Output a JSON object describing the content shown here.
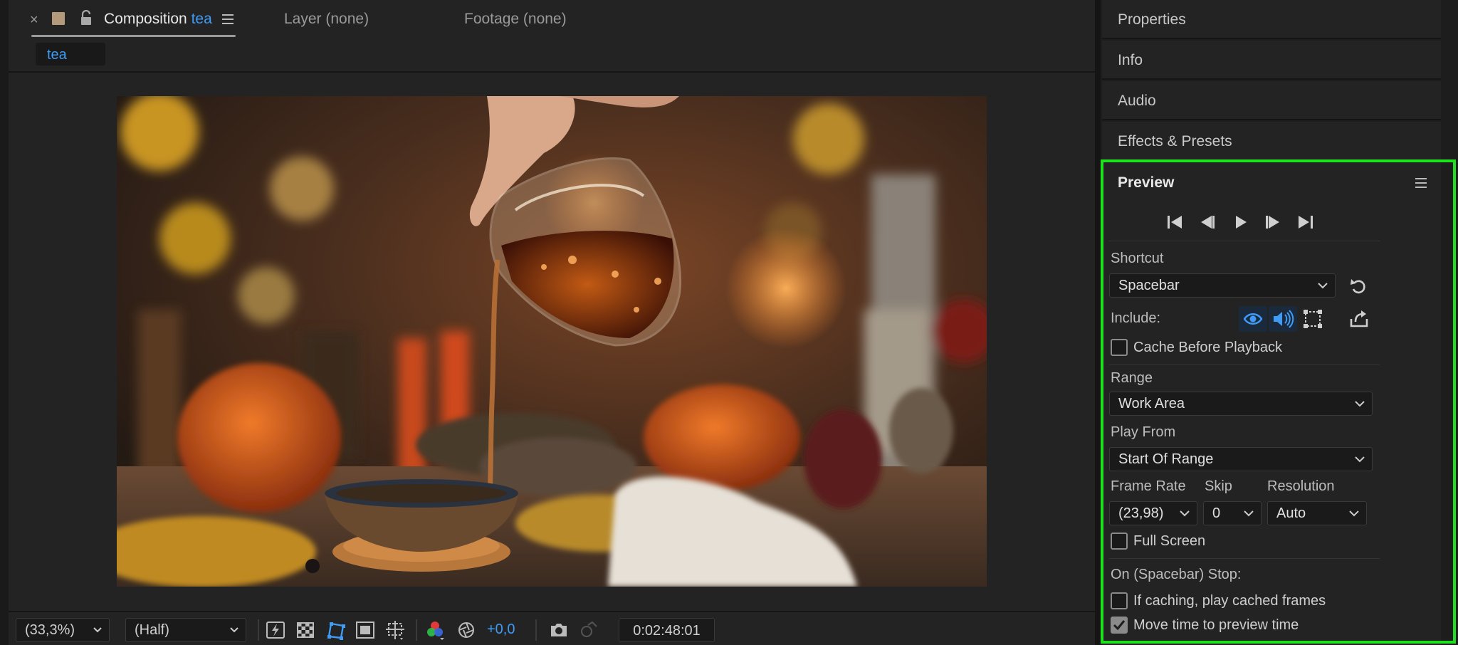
{
  "composition_tab": {
    "prefix": "Composition",
    "name": "tea"
  },
  "layer_tab": {
    "label": "Layer (none)"
  },
  "footage_tab": {
    "label": "Footage (none)"
  },
  "breadcrumb": {
    "label": "tea"
  },
  "viewer_toolbar": {
    "magnification": "(33,3%)",
    "resolution": "(Half)",
    "exposure": "+0,0",
    "timecode": "0:02:48:01"
  },
  "panels": {
    "properties": "Properties",
    "info": "Info",
    "audio": "Audio",
    "effects_presets": "Effects & Presets"
  },
  "preview": {
    "title": "Preview",
    "shortcut_label": "Shortcut",
    "shortcut_value": "Spacebar",
    "include_label": "Include:",
    "cache_before_playback": "Cache Before Playback",
    "range_label": "Range",
    "range_value": "Work Area",
    "play_from_label": "Play From",
    "play_from_value": "Start Of Range",
    "frame_rate_label": "Frame Rate",
    "frame_rate_value": "(23,98)",
    "skip_label": "Skip",
    "skip_value": "0",
    "resolution_label": "Resolution",
    "resolution_value": "Auto",
    "full_screen": "Full Screen",
    "on_stop_label": "On (Spacebar) Stop:",
    "if_caching": "If caching, play cached frames",
    "move_time": "Move time to preview time"
  },
  "colors": {
    "accent_blue": "#3f9bf5",
    "highlight_green": "#1fe01f",
    "panel_bg": "#232323"
  }
}
